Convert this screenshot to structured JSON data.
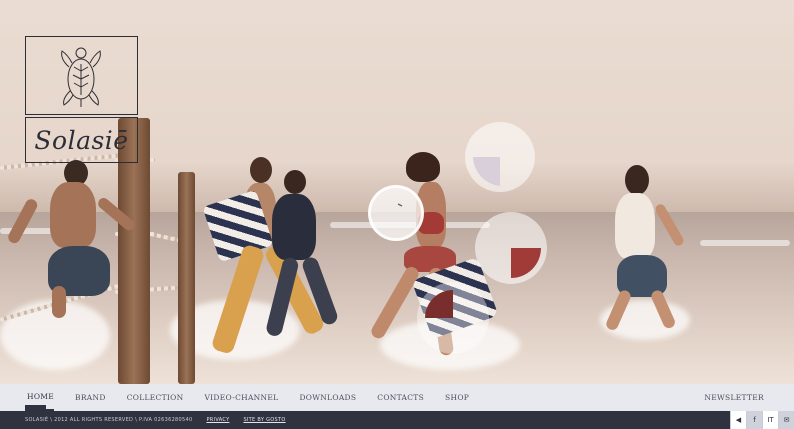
{
  "brand": {
    "name": "Solasiē",
    "logo_icon": "turtle-icon"
  },
  "nav": {
    "items": [
      {
        "label": "HOME",
        "active": true
      },
      {
        "label": "BRAND",
        "active": false
      },
      {
        "label": "COLLECTION",
        "active": false
      },
      {
        "label": "VIDEO-CHANNEL",
        "active": false
      },
      {
        "label": "DOWNLOADS",
        "active": false
      },
      {
        "label": "CONTACTS",
        "active": false
      },
      {
        "label": "SHOP",
        "active": false
      }
    ],
    "newsletter_label": "NEWSLETTER"
  },
  "footer": {
    "copyright": "SOLASIÉ \\ 2012 ALL RIGHTS RESERVED \\ P.IVA 02636280540",
    "privacy_label": "PRIVACY",
    "credit_label": "SITE BY GOSTO",
    "icons": [
      {
        "name": "speaker-icon",
        "glyph": "◀"
      },
      {
        "name": "facebook-icon",
        "glyph": "f"
      },
      {
        "name": "language-toggle",
        "glyph": "IT"
      },
      {
        "name": "mail-icon",
        "glyph": "✉"
      }
    ]
  },
  "colors": {
    "nav_bg": "#e7e9ee",
    "footer_bg": "#2f333f",
    "accent_dark_red": "#7a2d2d",
    "accent_red": "#a13b38",
    "accent_lilac": "#d9cfdb"
  }
}
